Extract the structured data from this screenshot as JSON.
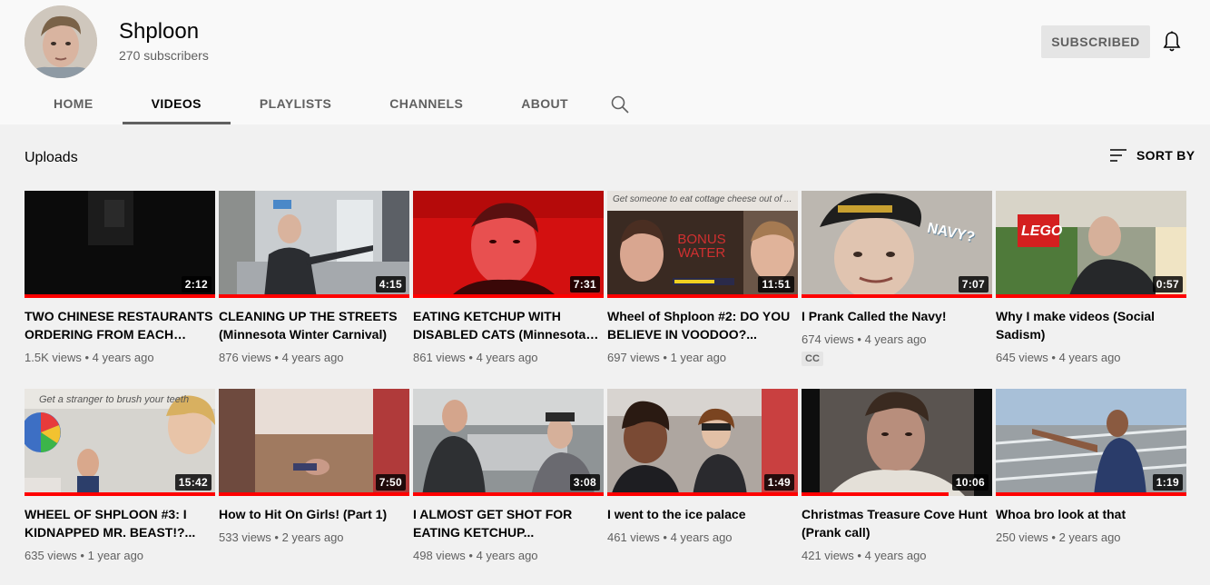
{
  "channel": {
    "name": "Shploon",
    "subscribers": "270 subscribers",
    "subscribe_label": "SUBSCRIBED"
  },
  "tabs": [
    {
      "label": "HOME"
    },
    {
      "label": "VIDEOS"
    },
    {
      "label": "PLAYLISTS"
    },
    {
      "label": "CHANNELS"
    },
    {
      "label": "ABOUT"
    }
  ],
  "section": {
    "title": "Uploads",
    "sort_label": "SORT BY"
  },
  "icons": {
    "bell": "bell-icon",
    "search": "search-icon",
    "sort": "sort-icon"
  },
  "colors": {
    "progress": "#ff0000",
    "text_secondary": "#606060",
    "background": "#f9f9f9"
  },
  "videos": [
    {
      "title": "TWO CHINESE RESTAURANTS ORDERING FROM EACH OTHER",
      "views": "1.5K views",
      "age": "4 years ago",
      "duration": "2:12",
      "cc": ""
    },
    {
      "title": "CLEANING UP THE STREETS (Minnesota Winter Carnival)",
      "views": "876 views",
      "age": "4 years ago",
      "duration": "4:15",
      "cc": ""
    },
    {
      "title": "EATING KETCHUP WITH DISABLED CATS (Minnesota Winter Carnival)",
      "views": "861 views",
      "age": "4 years ago",
      "duration": "7:31",
      "cc": ""
    },
    {
      "title": "Wheel of Shploon #2: DO YOU BELIEVE IN VOODOO?...",
      "views": "697 views",
      "age": "1 year ago",
      "duration": "11:51",
      "cc": "",
      "overlay_text": "Get someone to eat cottage cheese out of ...",
      "overlay_text2": "BONUS WATER"
    },
    {
      "title": "I Prank Called the Navy!",
      "views": "674 views",
      "age": "4 years ago",
      "duration": "7:07",
      "cc": "CC",
      "overlay_text": "NAVY?"
    },
    {
      "title": "Why I make videos (Social Sadism)",
      "views": "645 views",
      "age": "4 years ago",
      "duration": "0:57",
      "cc": "",
      "overlay_text": "LEGO"
    },
    {
      "title": "WHEEL OF SHPLOON #3: I KIDNAPPED MR. BEAST!?...",
      "views": "635 views",
      "age": "1 year ago",
      "duration": "15:42",
      "cc": "",
      "overlay_text": "Get a stranger to brush your teeth"
    },
    {
      "title": "How to Hit On Girls! (Part 1)",
      "views": "533 views",
      "age": "2 years ago",
      "duration": "7:50",
      "cc": ""
    },
    {
      "title": "I ALMOST GET SHOT FOR EATING KETCHUP...",
      "views": "498 views",
      "age": "4 years ago",
      "duration": "3:08",
      "cc": ""
    },
    {
      "title": "I went to the ice palace",
      "views": "461 views",
      "age": "4 years ago",
      "duration": "1:49",
      "cc": ""
    },
    {
      "title": "Christmas Treasure Cove Hunt (Prank call)",
      "views": "421 views",
      "age": "4 years ago",
      "duration": "10:06",
      "cc": ""
    },
    {
      "title": "Whoa bro look at that",
      "views": "250 views",
      "age": "2 years ago",
      "duration": "1:19",
      "cc": ""
    }
  ]
}
